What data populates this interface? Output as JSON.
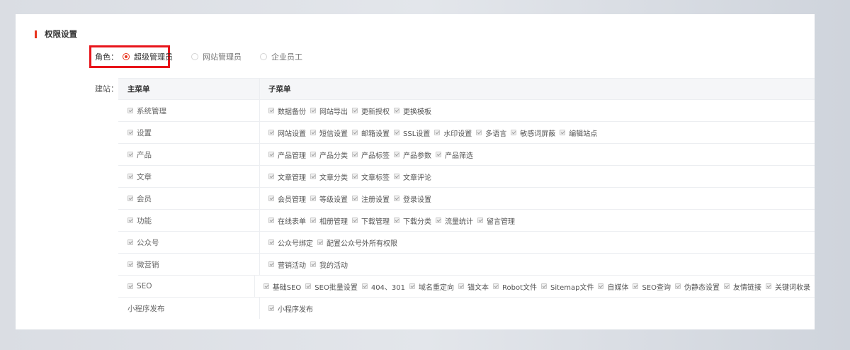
{
  "section_title": "权限设置",
  "role": {
    "label": "角色：",
    "options": [
      {
        "label": "超级管理员",
        "checked": true
      },
      {
        "label": "网站管理员",
        "checked": false
      },
      {
        "label": "企业员工",
        "checked": false
      }
    ]
  },
  "site_label": "建站：",
  "table": {
    "headers": {
      "main": "主菜单",
      "sub": "子菜单"
    },
    "rows": [
      {
        "main": "系统管理",
        "main_checkbox": true,
        "subs": [
          "数据备份",
          "网站导出",
          "更新授权",
          "更换模板"
        ]
      },
      {
        "main": "设置",
        "main_checkbox": true,
        "subs": [
          "网站设置",
          "短信设置",
          "邮箱设置",
          "SSL设置",
          "水印设置",
          "多语言",
          "敏感词屏蔽",
          "编辑站点"
        ]
      },
      {
        "main": "产品",
        "main_checkbox": true,
        "subs": [
          "产品管理",
          "产品分类",
          "产品标签",
          "产品参数",
          "产品筛选"
        ]
      },
      {
        "main": "文章",
        "main_checkbox": true,
        "subs": [
          "文章管理",
          "文章分类",
          "文章标签",
          "文章评论"
        ]
      },
      {
        "main": "会员",
        "main_checkbox": true,
        "subs": [
          "会员管理",
          "等级设置",
          "注册设置",
          "登录设置"
        ]
      },
      {
        "main": "功能",
        "main_checkbox": true,
        "subs": [
          "在线表单",
          "相册管理",
          "下载管理",
          "下载分类",
          "流量统计",
          "留言管理"
        ]
      },
      {
        "main": "公众号",
        "main_checkbox": true,
        "subs": [
          "公众号绑定",
          "配置公众号外所有权限"
        ]
      },
      {
        "main": "微营销",
        "main_checkbox": true,
        "subs": [
          "营销活动",
          "我的活动"
        ]
      },
      {
        "main": "SEO",
        "main_checkbox": true,
        "subs": [
          "基础SEO",
          "SEO批量设置",
          "404、301",
          "域名重定向",
          "锚文本",
          "Robot文件",
          "Sitemap文件",
          "自媒体",
          "SEO查询",
          "伪静态设置",
          "友情链接",
          "关键词收录"
        ]
      },
      {
        "main": "小程序发布",
        "main_checkbox": false,
        "subs": [
          "小程序发布"
        ]
      }
    ]
  }
}
